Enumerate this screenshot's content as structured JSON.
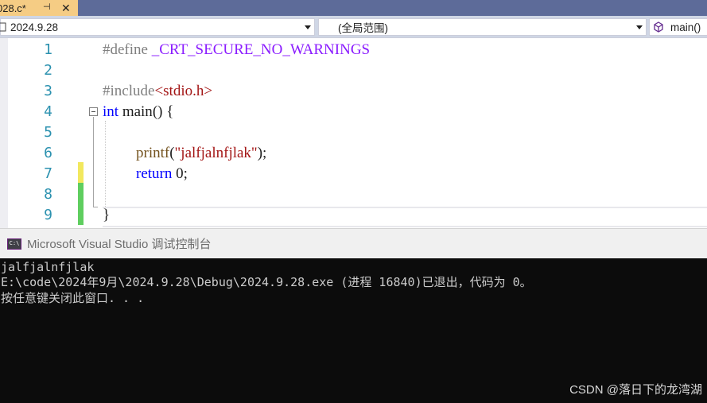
{
  "tab": {
    "title": "028.c*",
    "pin_icon": "pin-icon",
    "close_icon": "close-icon",
    "pin_glyph": "⊣",
    "close_glyph": "✕"
  },
  "navbar": {
    "project": "2024.9.28",
    "scope": "(全局范围)",
    "member": "main()",
    "member_icon": "function-cube-icon"
  },
  "editor": {
    "lines": [
      {
        "number": "1",
        "text": "#define _CRT_SECURE_NO_WARNINGS"
      },
      {
        "number": "2",
        "text": ""
      },
      {
        "number": "3",
        "text": "#include<stdio.h>"
      },
      {
        "number": "4",
        "text": "int main() {"
      },
      {
        "number": "5",
        "text": ""
      },
      {
        "number": "6",
        "text": "printf(\"jalfjalnfjlak\");"
      },
      {
        "number": "7",
        "text": "return 0;"
      },
      {
        "number": "8",
        "text": ""
      },
      {
        "number": "9",
        "text": "}"
      }
    ],
    "tokens": {
      "define": "#define",
      "macro": " _CRT_SECURE_NO_WARNINGS",
      "include": "#include",
      "header": "<stdio.h>",
      "int": "int",
      "main": " main",
      "main_rest": "() {",
      "printf": "printf",
      "paren_open": "(",
      "string": "\"jalfjalnfjlak\"",
      "paren_close": ");",
      "return": "return",
      "zero": " 0;",
      "brace_close": "}"
    },
    "colors": {
      "keyword": "#0000ff",
      "string": "#a31515",
      "preprocessor": "#808080",
      "macro": "#8a1bff",
      "line_number": "#2b91af",
      "change_unsaved": "#f2e85e",
      "change_saved": "#5fce5f"
    }
  },
  "console": {
    "title": "Microsoft Visual Studio 调试控制台",
    "icon_label": "C:\\",
    "output": [
      "jalfjalnfjlak",
      "E:\\code\\2024年9月\\2024.9.28\\Debug\\2024.9.28.exe (进程 16840)已退出，代码为 0。",
      "按任意键关闭此窗口. . ."
    ]
  },
  "watermark": "CSDN @落日下的龙湾湖"
}
